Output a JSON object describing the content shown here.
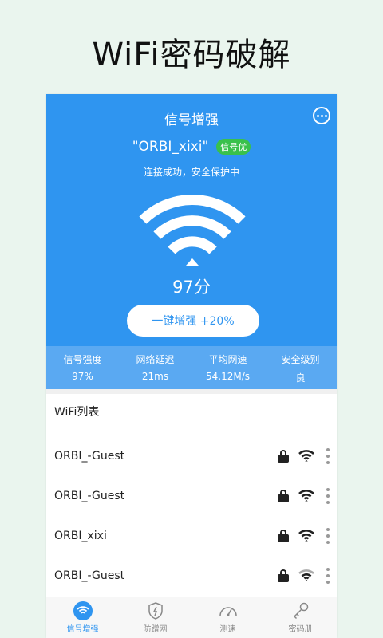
{
  "promo": {
    "title": "WiFi密码破解"
  },
  "header": {
    "title": "信号增强",
    "ssid": "\"ORBI_xixi\"",
    "badge": "信号优",
    "status": "连接成功，安全保护中",
    "score": "97分",
    "boost_label": "一键增强 +20%",
    "icon": "chat-icon"
  },
  "stats": [
    {
      "label": "信号强度",
      "value": "97%"
    },
    {
      "label": "网络延迟",
      "value": "21ms"
    },
    {
      "label": "平均网速",
      "value": "54.12M/s"
    },
    {
      "label": "安全级别",
      "value": "良"
    }
  ],
  "wifi_list": {
    "title": "WiFi列表",
    "networks": [
      {
        "name": "ORBI_-Guest",
        "signal_bars": 3,
        "locked": true
      },
      {
        "name": "ORBI_-Guest",
        "signal_bars": 3,
        "locked": true
      },
      {
        "name": "ORBI_xixi",
        "signal_bars": 3,
        "locked": true
      },
      {
        "name": "ORBI_-Guest",
        "signal_bars": 2,
        "locked": true
      }
    ]
  },
  "tabs": [
    {
      "label": "信号增强",
      "icon": "wifi-icon",
      "active": true
    },
    {
      "label": "防蹭网",
      "icon": "shield-icon",
      "active": false
    },
    {
      "label": "测速",
      "icon": "speedometer-icon",
      "active": false
    },
    {
      "label": "密码册",
      "icon": "key-icon",
      "active": false
    }
  ],
  "colors": {
    "primary": "#2f95f0",
    "stats_bg": "#5aa9f2",
    "badge": "#39c14b",
    "page_bg": "#eaf5ee"
  }
}
